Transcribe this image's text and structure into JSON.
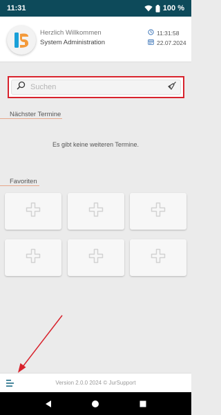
{
  "status_bar": {
    "time": "11:31",
    "battery": "100 %",
    "icons": [
      "wifi-icon",
      "battery-icon"
    ]
  },
  "header": {
    "welcome": "Herzlich Willkommen",
    "user": "System Administration",
    "clock": "11:31:58",
    "date": "22.07.2024",
    "icons": [
      "app-logo",
      "clock-icon",
      "calendar-icon"
    ]
  },
  "search": {
    "placeholder": "Suchen",
    "value": "",
    "icons": [
      "search-icon",
      "broom-icon"
    ]
  },
  "appointments": {
    "title": "Nächster Termine",
    "empty_message": "Es gibt keine weiteren Termine."
  },
  "favorites": {
    "title": "Favoriten",
    "tiles": [
      {
        "icon": "plus-icon"
      },
      {
        "icon": "plus-icon"
      },
      {
        "icon": "plus-icon"
      },
      {
        "icon": "plus-icon"
      },
      {
        "icon": "plus-icon"
      },
      {
        "icon": "plus-icon"
      }
    ]
  },
  "footer": {
    "version": "Version 2.0.0 2024 © JurSupport",
    "icons": [
      "menu-icon"
    ]
  },
  "navbar": {
    "icons": [
      "back-icon",
      "home-icon",
      "recents-icon"
    ]
  },
  "colors": {
    "status_bar": "#0d4a5a",
    "accent_orange": "#e6a68a",
    "highlight_red": "#d8222c",
    "logo_blue": "#1aa0d8",
    "logo_orange": "#f39a3b"
  }
}
